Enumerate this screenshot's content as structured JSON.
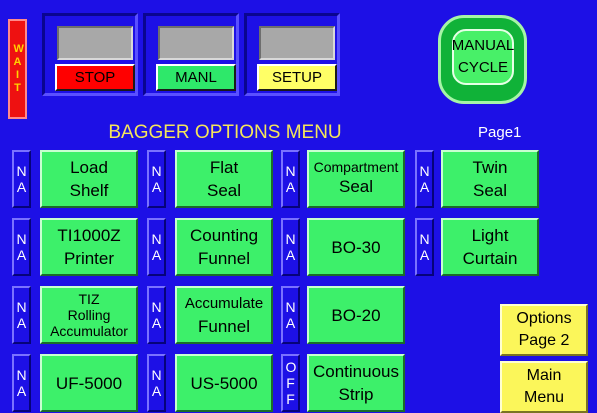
{
  "status": {
    "wait_label": "WAIT"
  },
  "controls": {
    "stop": "STOP",
    "manual": "MANL",
    "setup": "SETUP"
  },
  "colors": {
    "background": "#1d10e6",
    "stop": "#ff0000",
    "manual": "#2ee86a",
    "setup": "#ffff66",
    "option_button": "#3df06a",
    "title_text": "#f5e65a",
    "nav_button": "#fbf65a",
    "wait_indicator": "#ee1111"
  },
  "cycle": {
    "line1": "MANUAL",
    "line2": "CYCLE"
  },
  "menu": {
    "title": "BAGGER OPTIONS MENU",
    "page": "Page1"
  },
  "options": [
    {
      "tag": "NA",
      "line1": "Load",
      "line2": "Shelf"
    },
    {
      "tag": "NA",
      "line1": "Flat",
      "line2": "Seal"
    },
    {
      "tag": "NA",
      "line1": "Compartment",
      "line2": "Seal"
    },
    {
      "tag": "NA",
      "line1": "Twin",
      "line2": "Seal"
    },
    {
      "tag": "NA",
      "line1": "TI1000Z",
      "line2": "Printer"
    },
    {
      "tag": "NA",
      "line1": "Counting",
      "line2": "Funnel"
    },
    {
      "tag": "NA",
      "line1": "BO-30",
      "line2": ""
    },
    {
      "tag": "NA",
      "line1": "Light",
      "line2": "Curtain"
    },
    {
      "tag": "NA",
      "line1": "TIZ",
      "line2": "Rolling",
      "line3": "Accumulator"
    },
    {
      "tag": "NA",
      "line1": "Accumulate",
      "line2": "Funnel"
    },
    {
      "tag": "NA",
      "line1": "BO-20",
      "line2": ""
    },
    {
      "tag": "NA",
      "line1": "UF-5000",
      "line2": ""
    },
    {
      "tag": "NA",
      "line1": "US-5000",
      "line2": ""
    },
    {
      "tag": "OFF",
      "line1": "Continuous",
      "line2": "Strip"
    }
  ],
  "nav": {
    "options_line1": "Options",
    "options_line2": "Page 2",
    "main_line1": "Main",
    "main_line2": "Menu"
  }
}
